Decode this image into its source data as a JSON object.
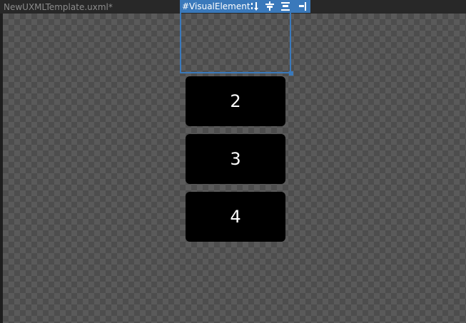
{
  "document": {
    "title": "NewUXMLTemplate.uxml*"
  },
  "selection": {
    "name": "#VisualElement",
    "tools": [
      {
        "icon": "sort-icon"
      },
      {
        "icon": "align-center-icon"
      },
      {
        "icon": "distribute-vertical-icon"
      },
      {
        "icon": "align-right-icon"
      }
    ]
  },
  "items": [
    {
      "label": "2"
    },
    {
      "label": "3"
    },
    {
      "label": "4"
    }
  ],
  "colors": {
    "selection": "#3a79bb",
    "item_background": "#000000",
    "item_text": "#ffffff"
  }
}
